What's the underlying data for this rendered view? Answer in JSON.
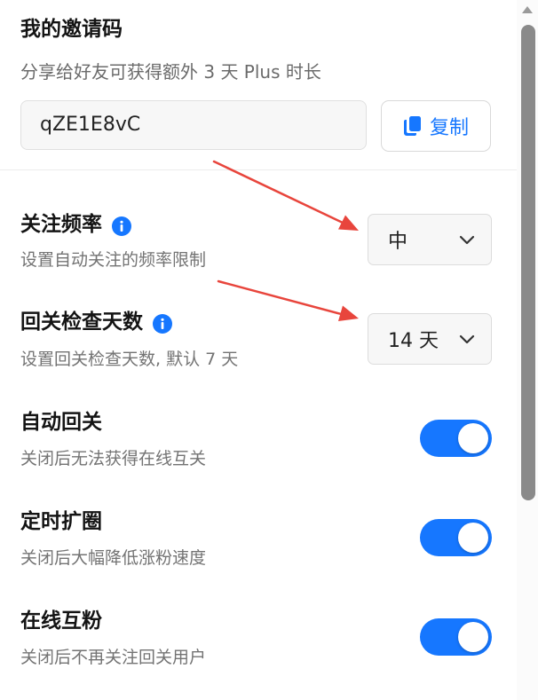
{
  "invite": {
    "title": "我的邀请码",
    "subtitle": "分享给好友可获得额外 3 天 Plus 时长",
    "code": "qZE1E8vC",
    "copy_label": "复制"
  },
  "settings": {
    "follow_rate": {
      "title": "关注频率",
      "desc": "设置自动关注的频率限制",
      "value": "中"
    },
    "check_days": {
      "title": "回关检查天数",
      "desc": "设置回关检查天数, 默认 7 天",
      "value": "14 天"
    },
    "auto_followback": {
      "title": "自动回关",
      "desc": "关闭后无法获得在线互关",
      "enabled": true
    },
    "scheduled_expand": {
      "title": "定时扩圈",
      "desc": "关闭后大幅降低涨粉速度",
      "enabled": true
    },
    "online_mutual": {
      "title": "在线互粉",
      "desc": "关闭后不再关注回关用户",
      "enabled": true
    }
  },
  "icons": {
    "copy": "copy-icon",
    "info": "info-icon",
    "chevron": "chevron-down-icon",
    "scroll_up": "scroll-up-arrow-icon"
  },
  "colors": {
    "accent": "#1677ff",
    "annotation_arrow": "#e8453c",
    "subtext": "#737373",
    "scroll_thumb": "#8a8a8a"
  }
}
